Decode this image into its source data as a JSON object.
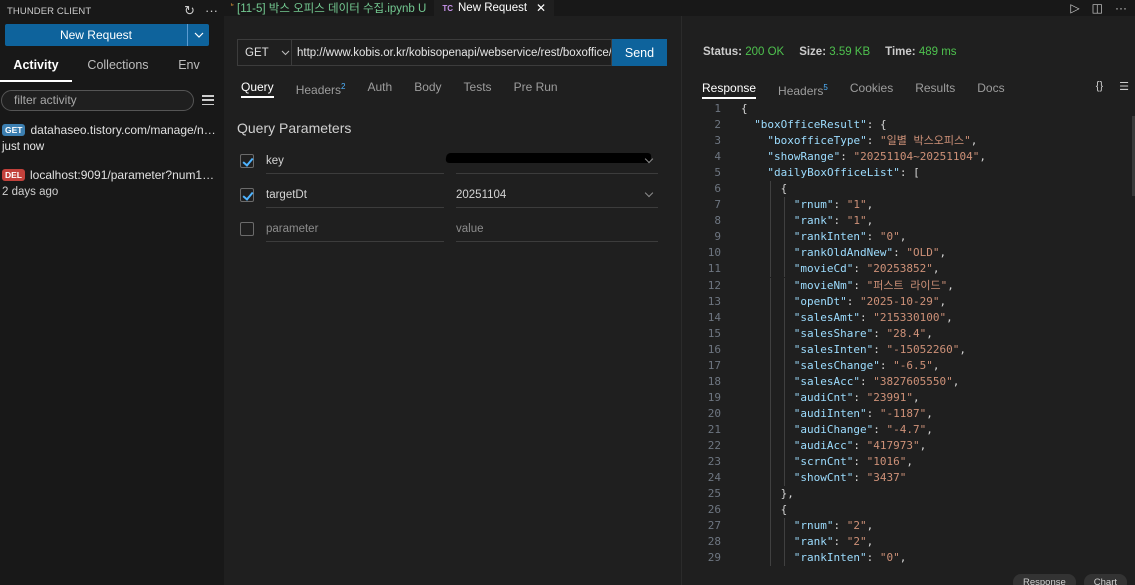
{
  "sidebar": {
    "title": "THUNDER CLIENT",
    "new_request": "New Request",
    "tabs": [
      "Activity",
      "Collections",
      "Env"
    ],
    "filter_placeholder": "filter activity",
    "activity": [
      {
        "method": "GET",
        "url": "datahaseo.tistory.com/manage/new...",
        "time": "just now"
      },
      {
        "method": "DEL",
        "url": "localhost:9091/parameter?num1=12...",
        "time": "2 days ago"
      }
    ]
  },
  "editor_tabs": [
    {
      "label": "[11-5] 박스 오피스 데이터 수집.ipynb U",
      "status": "modified"
    },
    {
      "label": "New Request",
      "icon": "TC"
    }
  ],
  "request": {
    "method": "GET",
    "url": "http://www.kobis.or.kr/kobisopenapi/webservice/rest/boxoffice/s",
    "send": "Send",
    "tabs": [
      {
        "label": "Query",
        "count": ""
      },
      {
        "label": "Headers",
        "count": "2"
      },
      {
        "label": "Auth",
        "count": ""
      },
      {
        "label": "Body",
        "count": ""
      },
      {
        "label": "Tests",
        "count": ""
      },
      {
        "label": "Pre Run",
        "count": ""
      }
    ],
    "query_title": "Query Parameters",
    "params": [
      {
        "checked": true,
        "key": "key",
        "value": ""
      },
      {
        "checked": true,
        "key": "targetDt",
        "value": "20251104"
      },
      {
        "checked": false,
        "key": "parameter",
        "value": "value"
      }
    ]
  },
  "response": {
    "status_label": "Status:",
    "status": "200 OK",
    "size_label": "Size:",
    "size": "3.59 KB",
    "time_label": "Time:",
    "time": "489 ms",
    "tabs": [
      {
        "label": "Response",
        "count": ""
      },
      {
        "label": "Headers",
        "count": "5"
      },
      {
        "label": "Cookies",
        "count": ""
      },
      {
        "label": "Results",
        "count": ""
      },
      {
        "label": "Docs",
        "count": ""
      }
    ],
    "braces_icon": "{}",
    "bottom_chips": [
      "Response",
      "Chart"
    ],
    "lines": [
      {
        "n": "1",
        "i": 0,
        "t": "{"
      },
      {
        "n": "2",
        "i": 1,
        "k": "boxOfficeResult",
        "t": ": {"
      },
      {
        "n": "3",
        "i": 2,
        "k": "boxofficeType",
        "v": "일별 박스오피스",
        "c": ","
      },
      {
        "n": "4",
        "i": 2,
        "k": "showRange",
        "v": "20251104~20251104",
        "c": ","
      },
      {
        "n": "5",
        "i": 2,
        "k": "dailyBoxOfficeList",
        "t": ": ["
      },
      {
        "n": "6",
        "i": 3,
        "t": "{"
      },
      {
        "n": "7",
        "i": 4,
        "k": "rnum",
        "v": "1",
        "c": ","
      },
      {
        "n": "8",
        "i": 4,
        "k": "rank",
        "v": "1",
        "c": ","
      },
      {
        "n": "9",
        "i": 4,
        "k": "rankInten",
        "v": "0",
        "c": ","
      },
      {
        "n": "10",
        "i": 4,
        "k": "rankOldAndNew",
        "v": "OLD",
        "c": ","
      },
      {
        "n": "11",
        "i": 4,
        "k": "movieCd",
        "v": "20253852",
        "c": ","
      },
      {
        "n": "12",
        "i": 4,
        "k": "movieNm",
        "v": "퍼스트 라이드",
        "c": ","
      },
      {
        "n": "13",
        "i": 4,
        "k": "openDt",
        "v": "2025-10-29",
        "c": ","
      },
      {
        "n": "14",
        "i": 4,
        "k": "salesAmt",
        "v": "215330100",
        "c": ","
      },
      {
        "n": "15",
        "i": 4,
        "k": "salesShare",
        "v": "28.4",
        "c": ","
      },
      {
        "n": "16",
        "i": 4,
        "k": "salesInten",
        "v": "-15052260",
        "c": ","
      },
      {
        "n": "17",
        "i": 4,
        "k": "salesChange",
        "v": "-6.5",
        "c": ","
      },
      {
        "n": "18",
        "i": 4,
        "k": "salesAcc",
        "v": "3827605550",
        "c": ","
      },
      {
        "n": "19",
        "i": 4,
        "k": "audiCnt",
        "v": "23991",
        "c": ","
      },
      {
        "n": "20",
        "i": 4,
        "k": "audiInten",
        "v": "-1187",
        "c": ","
      },
      {
        "n": "21",
        "i": 4,
        "k": "audiChange",
        "v": "-4.7",
        "c": ","
      },
      {
        "n": "22",
        "i": 4,
        "k": "audiAcc",
        "v": "417973",
        "c": ","
      },
      {
        "n": "23",
        "i": 4,
        "k": "scrnCnt",
        "v": "1016",
        "c": ","
      },
      {
        "n": "24",
        "i": 4,
        "k": "showCnt",
        "v": "3437",
        "c": ""
      },
      {
        "n": "25",
        "i": 3,
        "t": "},"
      },
      {
        "n": "26",
        "i": 3,
        "t": "{"
      },
      {
        "n": "27",
        "i": 4,
        "k": "rnum",
        "v": "2",
        "c": ","
      },
      {
        "n": "28",
        "i": 4,
        "k": "rank",
        "v": "2",
        "c": ","
      },
      {
        "n": "29",
        "i": 4,
        "k": "rankInten",
        "v": "0",
        "c": ","
      }
    ]
  }
}
